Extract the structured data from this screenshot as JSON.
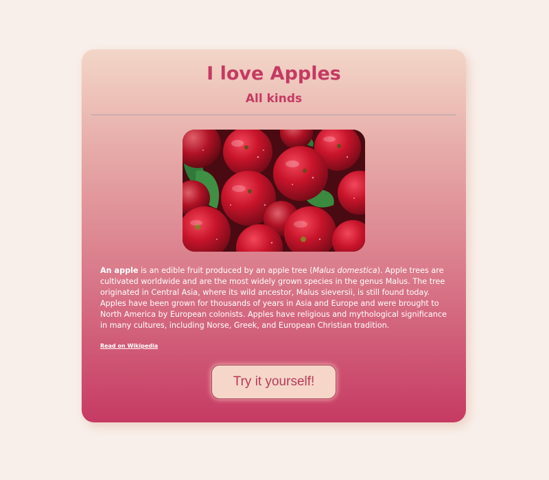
{
  "header": {
    "title": "I love Apples",
    "subtitle": "All kinds"
  },
  "image": {
    "alt_description_icon": "apples-photo"
  },
  "description": {
    "lead_bold": "An apple",
    "part1": " is an edible fruit produced by an apple tree (",
    "italic": "Malus domestica",
    "part2": "). Apple trees are cultivated worldwide and are the most widely grown species in the genus Malus. The tree originated in Central Asia, where its wild ancestor, Malus sieversii, is still found today. Apples have been grown for thousands of years in Asia and Europe and were brought to North America by European colonists. Apples have religious and mythological significance in many cultures, including Norse, Greek, and European Christian tradition."
  },
  "link": {
    "label": "Read on Wikipedia"
  },
  "cta": {
    "label": "Try it yourself!"
  },
  "colors": {
    "page_background": "#f9efea",
    "accent": "#c43a62",
    "button_background": "#f6d6c8"
  }
}
